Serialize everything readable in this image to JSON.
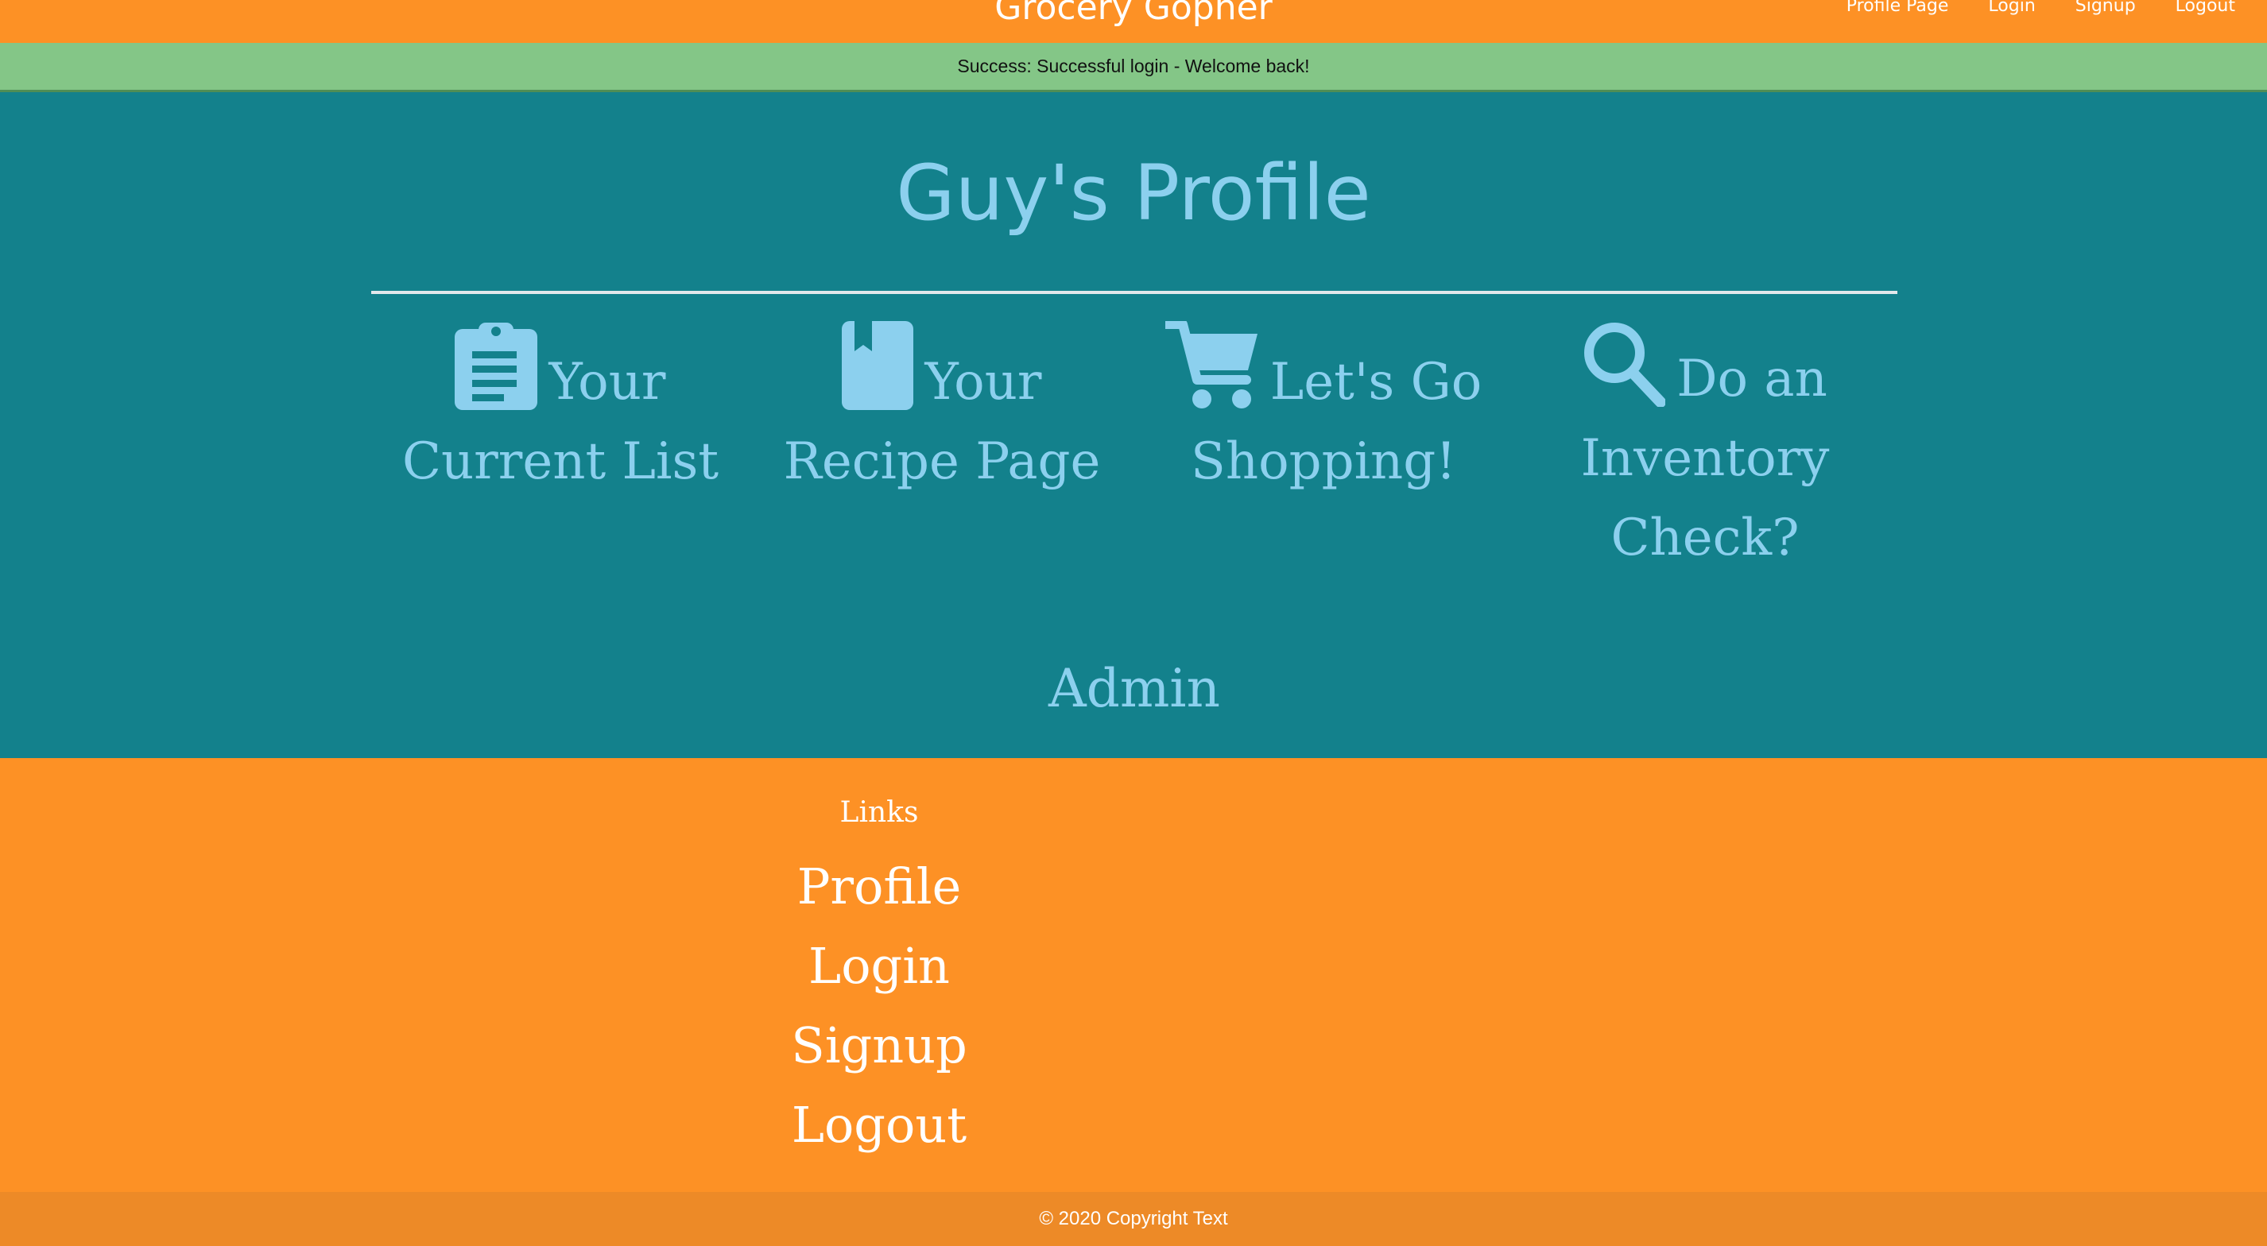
{
  "navbar": {
    "brand": "Grocery Gopher",
    "links": [
      "Profile Page",
      "Login",
      "Signup",
      "Logout"
    ]
  },
  "alert": {
    "message": "Success: Successful login - Welcome back!"
  },
  "profile": {
    "title": "Guy's Profile",
    "cards": [
      {
        "icon": "clipboard-icon",
        "label": "Your Current List"
      },
      {
        "icon": "book-icon",
        "label": "Your Recipe Page"
      },
      {
        "icon": "shopping-cart-icon",
        "label": "Let's Go Shopping!"
      },
      {
        "icon": "search-icon",
        "label": "Do an Inventory Check?"
      }
    ],
    "admin_label": "Admin"
  },
  "footer": {
    "heading": "Links",
    "links": [
      "Profile",
      "Login",
      "Signup",
      "Logout"
    ],
    "copyright": "© 2020 Copyright Text"
  },
  "colors": {
    "primary_orange": "#fd9125",
    "teal": "#13818c",
    "light_blue": "#8cd0ee",
    "success_green": "#84c687"
  }
}
